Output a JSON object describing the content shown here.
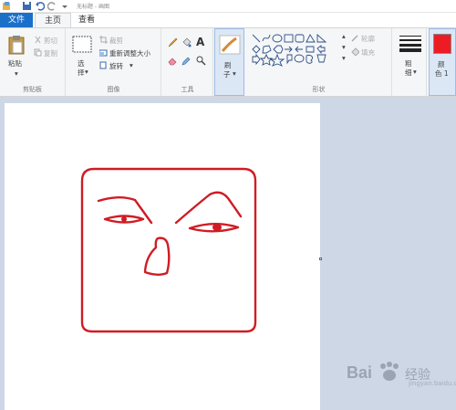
{
  "title_bar": {
    "title": "无标题 - 画图"
  },
  "tabs": [
    {
      "label": "文件"
    },
    {
      "label": "主页"
    },
    {
      "label": "查看"
    }
  ],
  "clipboard": {
    "paste_label": "粘贴",
    "cut_label": "剪切",
    "copy_label": "复制",
    "group_label": "剪贴板"
  },
  "image": {
    "select_label_1": "选",
    "select_label_2": "择",
    "crop_label": "裁剪",
    "resize_label": "重新调整大小",
    "rotate_label": "旋转",
    "group_label": "图像"
  },
  "tools": {
    "group_label": "工具"
  },
  "brushes": {
    "label_1": "刷",
    "label_2": "子"
  },
  "shapes": {
    "outline_label": "轮廓",
    "fill_label": "填充",
    "group_label": "形状"
  },
  "size": {
    "label_1": "粗",
    "label_2": "细"
  },
  "color1": {
    "label_1": "颜",
    "label_2": "色 1",
    "value": "#ed1c24"
  },
  "watermark": {
    "brand": "Bai",
    "suffix": "经验",
    "sub": "jingyan.baidu.com"
  },
  "colors": {
    "accent": "#1a6fc9",
    "drawing_stroke": "#d01c24",
    "workspace": "#cdd7e6"
  }
}
